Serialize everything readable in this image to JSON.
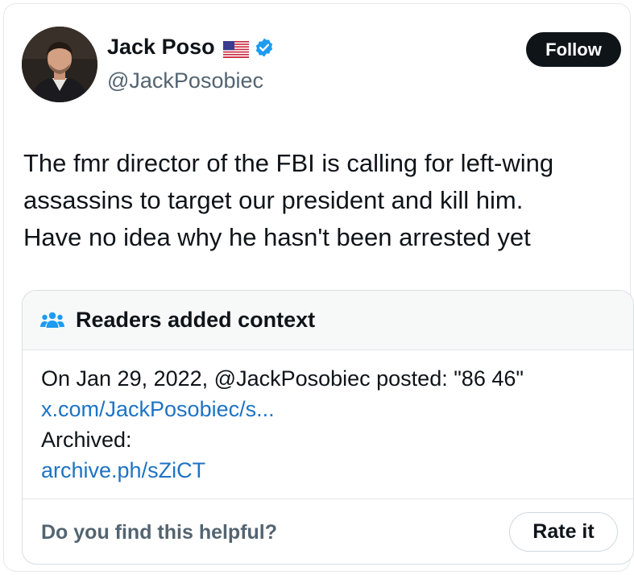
{
  "author": {
    "display_name": "Jack Poso",
    "handle": "@JackPosobiec",
    "flag_icon": "us-flag-icon",
    "verified_icon": "verified-badge-icon",
    "verified_color": "#1d9bf0"
  },
  "follow_label": "Follow",
  "tweet": {
    "lines": [
      "The fmr director of the FBI is calling for left-wing",
      "assassins to target our president and kill him.",
      "Have no idea why he hasn't been arrested yet"
    ]
  },
  "community_note": {
    "title": "Readers added context",
    "icon": "people-icon",
    "body_text": "On Jan 29, 2022, @JackPosobiec posted: \"86 46\"",
    "link1": "x.com/JackPosobiec/s...",
    "archived_label": "Archived:",
    "link2": "archive.ph/sZiCT",
    "link_color": "#1d73c4",
    "helpful_question": "Do you find this helpful?",
    "rate_label": "Rate it"
  }
}
